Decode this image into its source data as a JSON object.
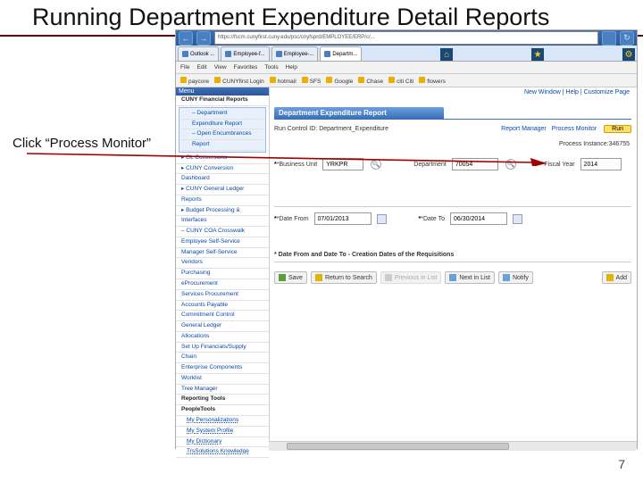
{
  "title": "Running Department Expenditure Detail Reports",
  "instruction": "Click “Process Monitor”",
  "browser": {
    "url": "https://fscm.cunyfirst.cuny.edu/psc/cnyfsprd/EMPLOYEE/ERP/c/...",
    "tabs": [
      {
        "label": "Outlook ..."
      },
      {
        "label": "Employee-f..."
      },
      {
        "label": "Employee-..."
      },
      {
        "label": "Departm..."
      }
    ],
    "menubar": [
      "File",
      "Edit",
      "View",
      "Favorites",
      "Tools",
      "Help"
    ],
    "favorites": [
      {
        "label": "paycore"
      },
      {
        "label": "CUNYfirst Login"
      },
      {
        "label": "hotmail"
      },
      {
        "label": "SFS"
      },
      {
        "label": "Google"
      },
      {
        "label": "Chase"
      },
      {
        "label": "citi Citi"
      },
      {
        "label": "flowers"
      }
    ]
  },
  "top_links": {
    "new_window": "New Window",
    "help": "Help",
    "customize": "Customize Page"
  },
  "menu": {
    "header": "Menu",
    "section": "CUNY Financial Reports",
    "items": [
      "– Department",
      "   Expenditure Report",
      "– Open Encumbrances",
      "   Report",
      "▸ GL Conversions",
      "▸ CUNY Conversion",
      "   Dashboard",
      "▸ CUNY General Ledger",
      "   Reports",
      "▸ Budget Processing &",
      "   Interfaces",
      "– CUNY COA Crosswalk",
      "Employee Self-Service",
      "Manager Self-Service",
      "Vendors",
      "Purchasing",
      "eProcurement",
      "Services Procurement",
      "Accounts Payable",
      "Commitment Control",
      "General Ledger",
      "Allocations",
      "Set Up Financials/Supply",
      "Chain",
      "Enterprise Components",
      "Worklist",
      "Tree Manager"
    ],
    "bold": [
      "Reporting Tools",
      "PeopleTools"
    ],
    "dashed": [
      "My Personalizations",
      "My System Profile",
      "My Dictionary",
      "TrsSolutions Knowledge"
    ]
  },
  "page": {
    "header": "Department Expenditure Report",
    "run_control_label": "Run Control ID:",
    "run_control_value": "Department_Expenditure",
    "report_manager": "Report Manager",
    "process_monitor": "Process Monitor",
    "run": "Run",
    "process_instance": "Process Instance:346755",
    "fields": {
      "bu_label": "*Business Unit",
      "bu_value": "YRKPR",
      "dept_label": "Department",
      "dept_value": "70054",
      "fy_label": "*Fiscal Year",
      "fy_value": "2014",
      "from_label": "*Date From",
      "from_value": "07/01/2013",
      "to_label": "*Date To",
      "to_value": "06/30/2014"
    },
    "note": "* Date From and Date To - Creation Dates of the Requisitions",
    "buttons": {
      "save": "Save",
      "return": "Return to Search",
      "prev": "Previous in List",
      "next": "Next in List",
      "notify": "Notify",
      "add": "Add"
    }
  },
  "page_number": "7"
}
